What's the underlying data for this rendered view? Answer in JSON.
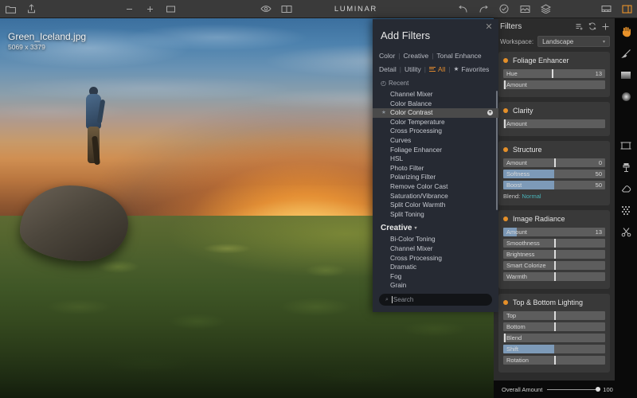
{
  "app": {
    "title": "LUMINAR"
  },
  "toolbar": {
    "left_icons": [
      {
        "name": "folder-icon",
        "glyph": "folder"
      },
      {
        "name": "share-icon",
        "glyph": "share"
      }
    ],
    "zoom_icons": [
      {
        "name": "zoom-out-icon",
        "glyph": "−"
      },
      {
        "name": "zoom-in-icon",
        "glyph": "+"
      },
      {
        "name": "fit-to-screen-icon",
        "glyph": "fit"
      }
    ],
    "view_icons": [
      {
        "name": "preview-eye-icon",
        "glyph": "eye"
      },
      {
        "name": "compare-split-icon",
        "glyph": "split"
      }
    ],
    "history_icons": [
      {
        "name": "undo-icon",
        "glyph": "undo"
      },
      {
        "name": "redo-icon",
        "glyph": "redo"
      },
      {
        "name": "sync-check-icon",
        "glyph": "check"
      }
    ],
    "right_icons": [
      {
        "name": "image-icon",
        "glyph": "image"
      },
      {
        "name": "layers-icon",
        "glyph": "layers"
      },
      {
        "name": "filmstrip-toggle-icon",
        "glyph": "filmstrip"
      },
      {
        "name": "right-panel-toggle-icon",
        "glyph": "panel",
        "active": true
      }
    ]
  },
  "image": {
    "filename": "Green_Iceland.jpg",
    "dimensions": "5069 x 3379"
  },
  "add_filters": {
    "title": "Add Filters",
    "close_label": "✕",
    "tabs_row1": [
      {
        "label": "Color",
        "active": false
      },
      {
        "label": "Creative",
        "active": false
      },
      {
        "label": "Tonal Enhance",
        "active": false
      }
    ],
    "tabs_row2": [
      {
        "label": "Detail",
        "active": false
      },
      {
        "label": "Utility",
        "active": false
      },
      {
        "label": "All",
        "active": true
      },
      {
        "label": "Favorites",
        "active": false
      }
    ],
    "recent_label": "Recent",
    "recent_items": [
      {
        "label": "Channel Mixer",
        "selected": false
      },
      {
        "label": "Color Balance",
        "selected": false
      },
      {
        "label": "Color Contrast",
        "selected": true
      },
      {
        "label": "Color Temperature",
        "selected": false
      },
      {
        "label": "Cross Processing",
        "selected": false
      },
      {
        "label": "Curves",
        "selected": false
      },
      {
        "label": "Foliage Enhancer",
        "selected": false
      },
      {
        "label": "HSL",
        "selected": false
      },
      {
        "label": "Photo Filter",
        "selected": false
      },
      {
        "label": "Polarizing Filter",
        "selected": false
      },
      {
        "label": "Remove Color Cast",
        "selected": false
      },
      {
        "label": "Saturation/Vibrance",
        "selected": false
      },
      {
        "label": "Split Color Warmth",
        "selected": false
      },
      {
        "label": "Split Toning",
        "selected": false
      }
    ],
    "category_label": "Creative",
    "category_items": [
      {
        "label": "Bi-Color Toning",
        "selected": false
      },
      {
        "label": "Channel Mixer",
        "selected": false
      },
      {
        "label": "Cross Processing",
        "selected": false
      },
      {
        "label": "Dramatic",
        "selected": false
      },
      {
        "label": "Fog",
        "selected": false
      },
      {
        "label": "Grain",
        "selected": false
      }
    ],
    "search_placeholder": "Search",
    "search_value": ""
  },
  "filters_panel": {
    "title": "Filters",
    "header_icons": [
      {
        "name": "add-to-list-icon"
      },
      {
        "name": "sync-icon"
      },
      {
        "name": "add-filter-plus-icon"
      }
    ],
    "workspace_label": "Workspace:",
    "workspace_value": "Landscape",
    "accent_color": "#e8922a",
    "slider_fill_color": "#7d9ab8",
    "blend_value_color": "#49b3b8",
    "filters": [
      {
        "name": "Foliage Enhancer",
        "sliders": [
          {
            "label": "Hue",
            "value": "13",
            "fill_pct": 0,
            "knob_pct": 48
          },
          {
            "label": "Amount",
            "value": "",
            "fill_pct": 0,
            "knob_pct": 1
          }
        ]
      },
      {
        "name": "Clarity",
        "sliders": [
          {
            "label": "Amount",
            "value": "",
            "fill_pct": 0,
            "knob_pct": 1
          }
        ]
      },
      {
        "name": "Structure",
        "sliders": [
          {
            "label": "Amount",
            "value": "0",
            "fill_pct": 0,
            "knob_pct": 50
          },
          {
            "label": "Softness",
            "value": "50",
            "fill_pct": 50,
            "knob_pct": -1
          },
          {
            "label": "Boost",
            "value": "50",
            "fill_pct": 50,
            "knob_pct": -1
          }
        ],
        "blend_label": "Blend:",
        "blend_value": "Normal"
      },
      {
        "name": "Image Radiance",
        "sliders": [
          {
            "label": "Amount",
            "value": "13",
            "fill_pct": 13,
            "knob_pct": -1
          },
          {
            "label": "Smoothness",
            "value": "",
            "fill_pct": 0,
            "knob_pct": 50
          },
          {
            "label": "Brightness",
            "value": "",
            "fill_pct": 0,
            "knob_pct": 50
          },
          {
            "label": "Smart Colorize",
            "value": "",
            "fill_pct": 0,
            "knob_pct": 50
          },
          {
            "label": "Warmth",
            "value": "",
            "fill_pct": 0,
            "knob_pct": 50
          }
        ]
      },
      {
        "name": "Top & Bottom Lighting",
        "sliders": [
          {
            "label": "Top",
            "value": "",
            "fill_pct": 0,
            "knob_pct": 50
          },
          {
            "label": "Bottom",
            "value": "",
            "fill_pct": 0,
            "knob_pct": 50
          },
          {
            "label": "Blend",
            "value": "",
            "fill_pct": 0,
            "knob_pct": 1
          },
          {
            "label": "Shift",
            "value": "",
            "fill_pct": 50,
            "knob_pct": -1
          },
          {
            "label": "Rotation",
            "value": "",
            "fill_pct": 0,
            "knob_pct": 50
          }
        ]
      }
    ]
  },
  "tools": [
    {
      "name": "hand-tool",
      "active": true
    },
    {
      "name": "brush-tool",
      "active": false
    },
    {
      "name": "gradient-mask-tool",
      "active": false
    },
    {
      "name": "radial-mask-tool",
      "active": false
    },
    {
      "name": "crop-tool",
      "active": false
    },
    {
      "name": "clone-stamp-tool",
      "active": false
    },
    {
      "name": "erase-tool",
      "active": false
    },
    {
      "name": "denoise-tool",
      "active": false
    },
    {
      "name": "scissors-tool",
      "active": false
    }
  ],
  "bottom_bar": {
    "overall_amount_label": "Overall Amount",
    "overall_amount_value": "100"
  }
}
